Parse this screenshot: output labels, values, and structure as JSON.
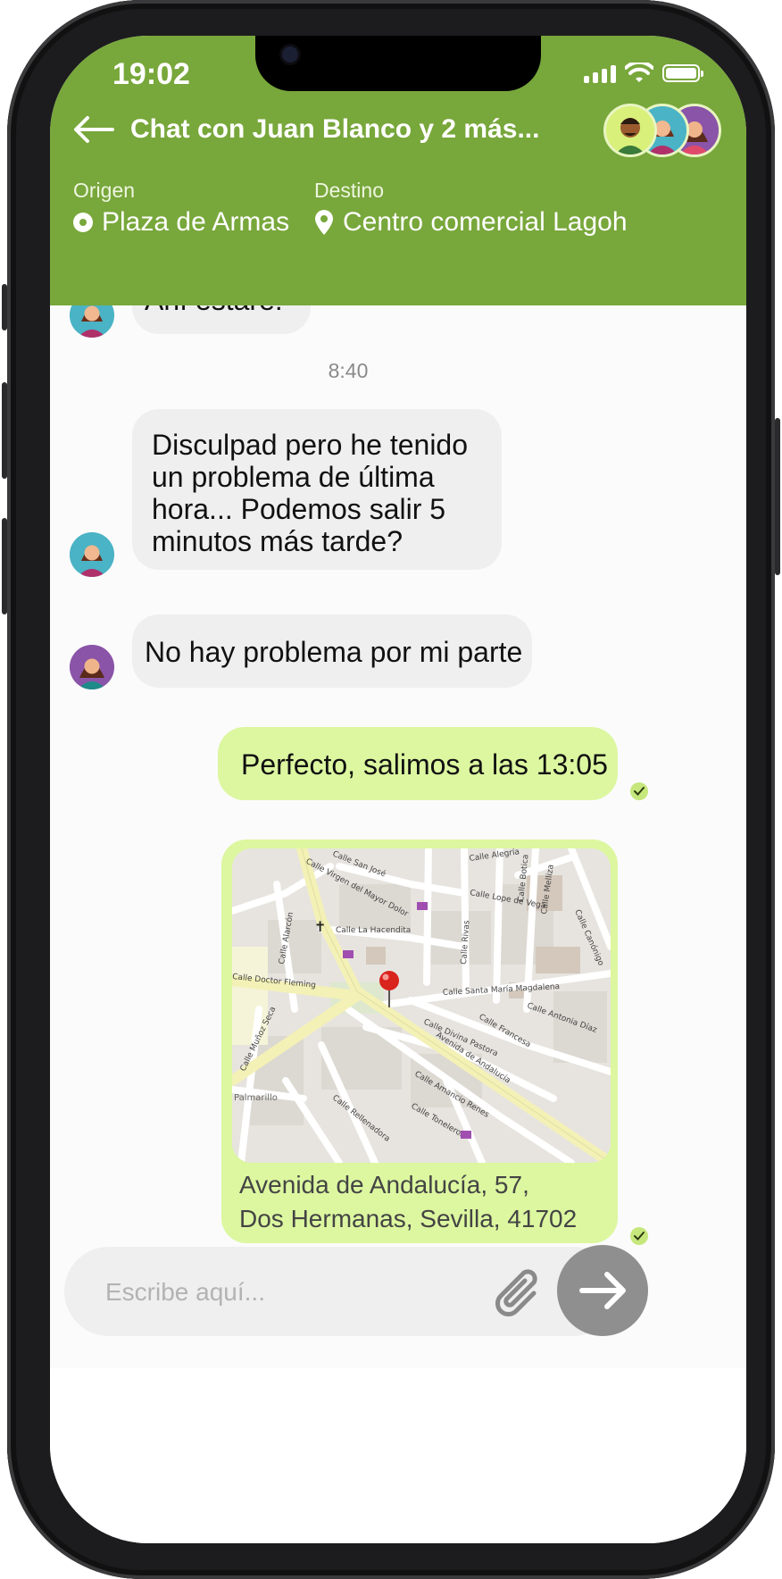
{
  "status_bar": {
    "time": "19:02",
    "icons": [
      "signal-icon",
      "wifi-icon",
      "battery-icon"
    ]
  },
  "header": {
    "back_icon": "arrow-left-icon",
    "title": "Chat con Juan Blanco y 2 más...",
    "origin": {
      "label": "Origen",
      "value": "Plaza de Armas"
    },
    "destination": {
      "label": "Destino",
      "value": "Centro comercial Lagoh"
    }
  },
  "messages": {
    "partial_top": "Ahí estaré!",
    "time_separator": "8:40",
    "incoming_1": "Disculpad pero he tenido un problema de última hora... Podemos salir 5 minutos más tarde?",
    "incoming_2": "No hay problema por mi parte",
    "outgoing_1": "Perfecto, salimos a las 13:05",
    "location": {
      "address_line1": "Avenida de Andalucía, 57,",
      "address_line2": "Dos Hermanas, Sevilla, 41702",
      "streets": {
        "s1": "Calle Virgen del Mayor Dolor",
        "s2": "Calle San José",
        "s3": "Calle Alegría",
        "s4": "Calle Lope de Vega",
        "s5": "Calle La Hacendita",
        "s6": "Calle Doctor Fleming",
        "s7": "Calle Santa María Magdalena",
        "s8": "Avenida de Andalucía",
        "s9": "Calle Divina Pastora",
        "s10": "Calle Francesa",
        "s11": "Calle Amancio Renes",
        "s12": "Calle Toneleros",
        "s13": "Palmarillo",
        "s14": "Calle Alarcón",
        "s15": "Calle Rivas",
        "s16": "Calle Antonia Díaz",
        "s17": "Calle Muñoz Seca",
        "s18": "Calle Botica",
        "s19": "Calle Melliza",
        "s20": "Calle Canónigo",
        "s21": "Calle Rellenadora"
      }
    }
  },
  "composer": {
    "placeholder": "Escribe aquí...",
    "attach_icon": "paperclip-icon",
    "send_icon": "arrow-right-icon"
  },
  "colors": {
    "header": "#78a73b",
    "outgoing_bubble": "#dcf7a0",
    "incoming_bubble": "#efefef",
    "send_button": "#8f8f8f"
  }
}
